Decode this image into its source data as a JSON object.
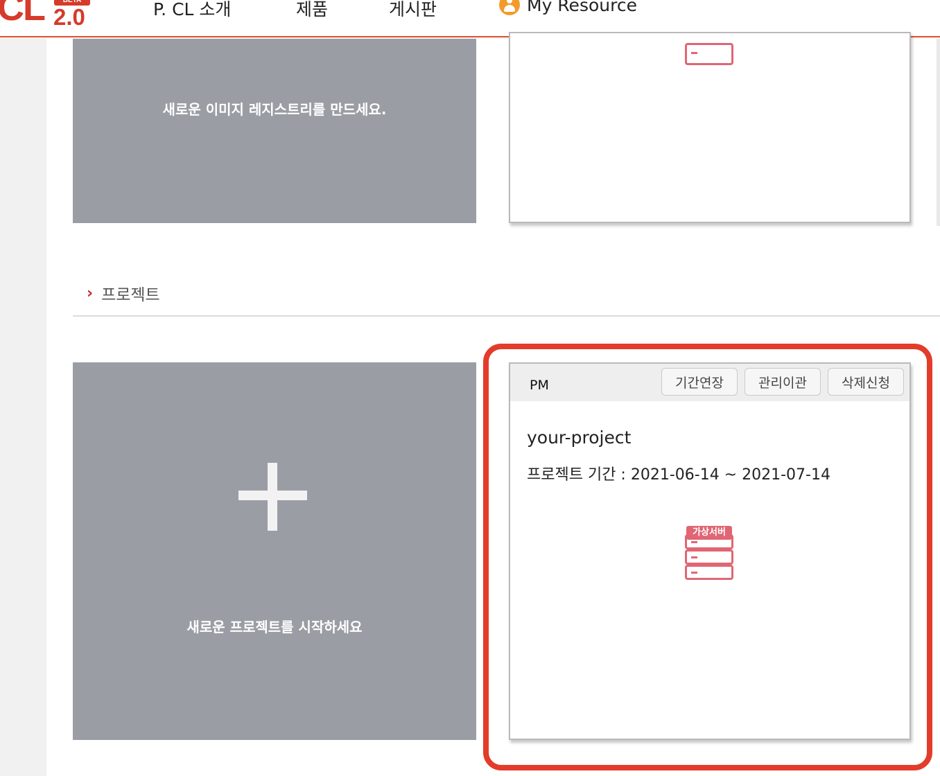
{
  "logo": {
    "text": "CL",
    "badge": "BETA",
    "version": "2.0"
  },
  "nav": {
    "items": [
      "P. CL 소개",
      "제품",
      "게시판"
    ],
    "my_resource": "My Resource",
    "user_icon": "user-icon"
  },
  "registry_card": {
    "caption": "새로운 이미지 레지스트리를 만드세요."
  },
  "top_resource_card": {
    "icon": "server-icon"
  },
  "projects_section": {
    "title": "프로젝트",
    "chevron_icon": "chevron-right-icon"
  },
  "new_project_card": {
    "caption": "새로운 프로젝트를 시작하세요",
    "icon": "plus-icon"
  },
  "project_card": {
    "role": "PM",
    "buttons": [
      "기간연장",
      "관리이관",
      "삭제신청"
    ],
    "name": "your-project",
    "period": "프로젝트 기간 : 2021-06-14 ~ 2021-07-14",
    "server_label": "가상서버",
    "server_icon": "server-icon"
  },
  "colors": {
    "brand": "#d63a2a",
    "highlight": "#e33c2a",
    "server_icon": "#e06674",
    "gray_card": "#9a9da4"
  }
}
